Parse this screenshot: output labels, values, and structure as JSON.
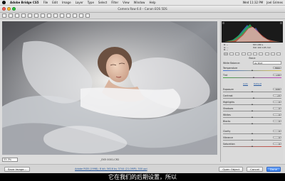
{
  "menubar": {
    "items": [
      "Adobe Bridge CS5",
      "File",
      "Edit",
      "Image",
      "Layer",
      "Type",
      "Select",
      "Filter",
      "View",
      "Window",
      "Help"
    ],
    "clock": "Wed 11:32 PM",
    "user": "Joel Grimes"
  },
  "window": {
    "title": "Camera Raw 6.0  –  Canon EOS 5DS"
  },
  "image": {
    "filename": "_EX5 0001.CR2",
    "zoom": "33.3%"
  },
  "readout": {
    "left": [
      "R: --",
      "G: --",
      "B: --"
    ],
    "right": [
      "f/8  1/80 s",
      "ISO 100  105 mm",
      ""
    ]
  },
  "panel": {
    "section_title": "Basic",
    "white_balance_label": "White Balance:",
    "white_balance_value": "As Shot",
    "auto_label": "Auto",
    "default_label": "Default",
    "controls": [
      {
        "label": "Temperature",
        "value": "5500",
        "level": 0.5
      },
      {
        "label": "Tint",
        "value": "+10",
        "level": 0.53
      },
      {
        "label": "Exposure",
        "value": "0.00",
        "level": 0.5
      },
      {
        "label": "Contrast",
        "value": "+5",
        "level": 0.53
      },
      {
        "label": "Highlights",
        "value": "0",
        "level": 0.5
      },
      {
        "label": "Shadows",
        "value": "0",
        "level": 0.5
      },
      {
        "label": "Whites",
        "value": "0",
        "level": 0.5
      },
      {
        "label": "Blacks",
        "value": "0",
        "level": 0.5
      },
      {
        "label": "Clarity",
        "value": "0",
        "level": 0.5
      },
      {
        "label": "Vibrance",
        "value": "0",
        "level": 0.5
      },
      {
        "label": "Saturation",
        "value": "0",
        "level": 0.5
      }
    ]
  },
  "bottom": {
    "save_label": "Save Image...",
    "workflow_label": "Adobe RGB (1998); 8 bit; 5616 by 3744 (21.0MP); 300 ppi",
    "open_label": "Open Object",
    "cancel_label": "Cancel",
    "done_label": "Done"
  },
  "subtitle": "它在我们的后期设置，所以",
  "colors": {
    "accent": "#2f78e6",
    "background": "#dcdcdc"
  }
}
